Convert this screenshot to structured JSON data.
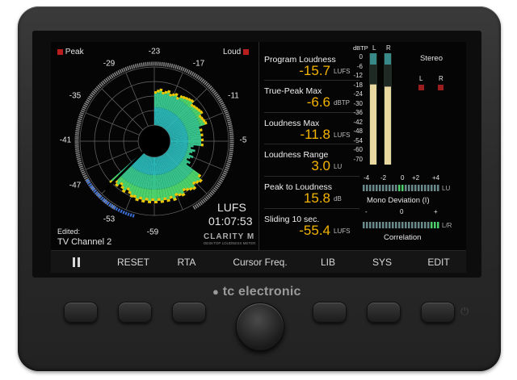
{
  "radar": {
    "peak_label": "Peak",
    "loud_label": "Loud",
    "scale": [
      "-23",
      "-29",
      "-17",
      "-35",
      "-11",
      "-41",
      "-5",
      "-47",
      "-53",
      "-59"
    ],
    "unit": "LUFS",
    "time": "01:07:53",
    "edited_label": "Edited:",
    "program_name": "TV Channel 2",
    "logo_text": "CLARITY M",
    "logo_sub": "DESKTOP LOUDNESS METER"
  },
  "meters": [
    {
      "title": "Program Loudness",
      "value": "-15.7",
      "unit": "LUFS"
    },
    {
      "title": "True-Peak Max",
      "value": "-6.6",
      "unit": "dBTP"
    },
    {
      "title": "Loudness Max",
      "value": "-11.8",
      "unit": "LUFS"
    },
    {
      "title": "Loudness Range",
      "value": "3.0",
      "unit": "LU"
    },
    {
      "title": "Peak to Loudness",
      "value": "15.8",
      "unit": "dB"
    },
    {
      "title": "Sliding 10 sec.",
      "value": "-55.4",
      "unit": "LUFS"
    }
  ],
  "bars": {
    "header": "dBTP",
    "ch_left": "L",
    "ch_right": "R",
    "scale": [
      "0",
      "-6",
      "-12",
      "-18",
      "-24",
      "-30",
      "-36",
      "-42",
      "-48",
      "-54",
      "-60",
      "-70"
    ],
    "level_left": 0.72,
    "level_right": 0.7
  },
  "stereo": {
    "label": "Stereo",
    "left": "L",
    "right": "R"
  },
  "deviation": {
    "ticks": [
      "-4",
      "-2",
      "0",
      "+2",
      "+4"
    ],
    "unit": "LU",
    "label": "Mono Deviation (I)"
  },
  "correlation": {
    "ticks": [
      "-",
      "0",
      "+"
    ],
    "unit": "L/R",
    "label": "Correlation"
  },
  "menu": [
    "RESET",
    "RTA",
    "Cursor Freq.",
    "LIB",
    "SYS",
    "EDIT"
  ],
  "brand": "tc electronic",
  "colors": {
    "accent": "#f5b400",
    "green": "#4bd06a",
    "cyan": "#2ab3b3",
    "blue": "#3b6fd6",
    "red": "#b81e1e"
  }
}
